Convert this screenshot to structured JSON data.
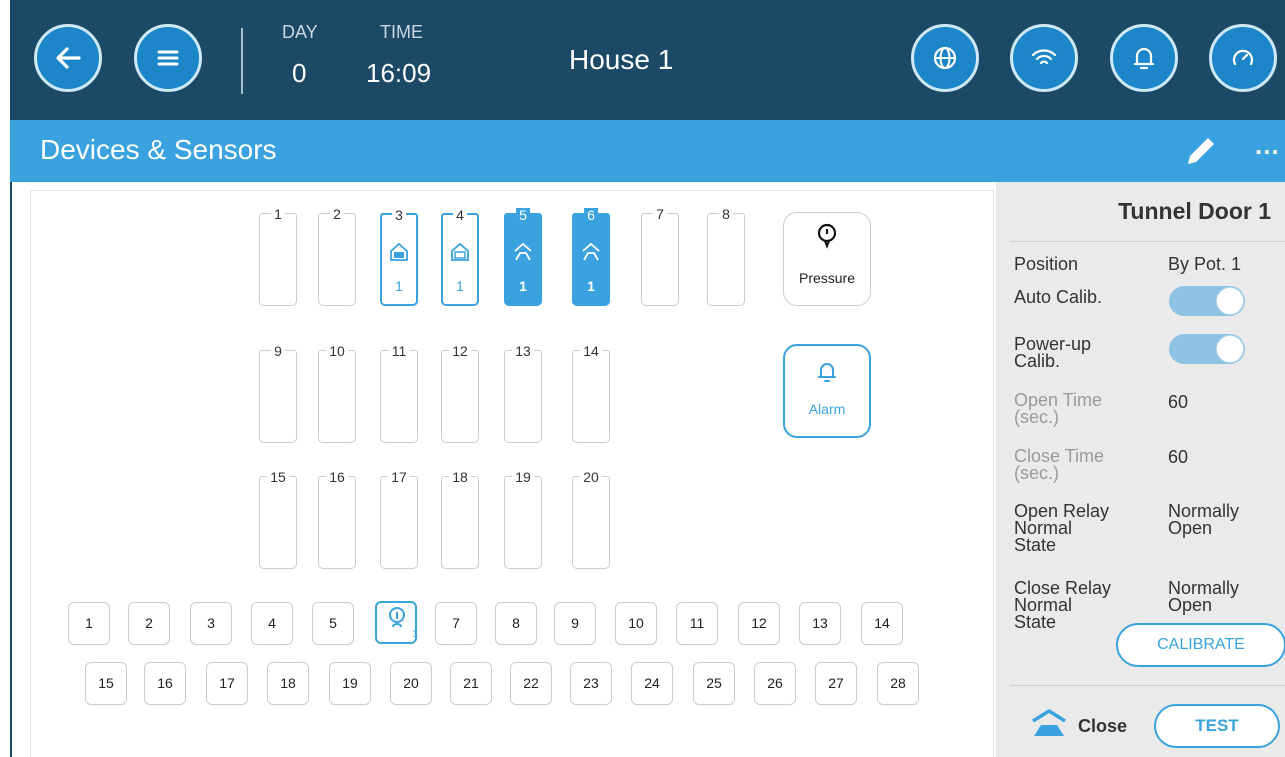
{
  "header": {
    "day_label": "DAY",
    "day_value": "0",
    "time_label": "TIME",
    "time_value": "16:09",
    "house_title": "House 1",
    "buttons": [
      "back-arrow-icon",
      "menu-icon",
      "globe-icon",
      "wifi-icon",
      "bell-icon",
      "gauge-icon"
    ]
  },
  "subheader": {
    "title": "Devices & Sensors",
    "edit_icon": "pencil-icon",
    "more_icon": "more-dots-icon",
    "more_label": "..."
  },
  "relays": {
    "row1": [
      {
        "num": "1",
        "state": "empty",
        "sub": ""
      },
      {
        "num": "2",
        "state": "empty",
        "sub": ""
      },
      {
        "num": "3",
        "state": "active",
        "icon": "tunnel-door-open-icon",
        "sub": "1"
      },
      {
        "num": "4",
        "state": "active",
        "icon": "tunnel-door-close-icon",
        "sub": "1"
      },
      {
        "num": "5",
        "state": "filled",
        "icon": "tunnel-door-open-icon",
        "sub": "1"
      },
      {
        "num": "6",
        "state": "filled",
        "icon": "tunnel-door-close-icon",
        "sub": "1"
      },
      {
        "num": "7",
        "state": "empty",
        "sub": ""
      },
      {
        "num": "8",
        "state": "empty",
        "sub": ""
      }
    ],
    "row2": [
      "9",
      "10",
      "11",
      "12",
      "13",
      "14"
    ],
    "row3": [
      "15",
      "16",
      "17",
      "18",
      "19",
      "20"
    ]
  },
  "sensors": {
    "pressure": {
      "label": "Pressure",
      "icon": "pressure-gauge-icon"
    },
    "alarm": {
      "label": "Alarm",
      "icon": "bell-icon"
    }
  },
  "analog_inputs": {
    "row1": [
      "1",
      "2",
      "3",
      "4",
      "5",
      "",
      "7",
      "8",
      "9",
      "10",
      "11",
      "12",
      "13",
      "14"
    ],
    "active": {
      "index": 5,
      "icon": "potentiometer-icon",
      "sub": "1"
    },
    "row2": [
      "15",
      "16",
      "17",
      "18",
      "19",
      "20",
      "21",
      "22",
      "23",
      "24",
      "25",
      "26",
      "27",
      "28"
    ]
  },
  "panel": {
    "title": "Tunnel Door 1",
    "position_label": "Position",
    "position_value": "By Pot. 1",
    "auto_calib_label": "Auto Calib.",
    "auto_calib_on": true,
    "powerup_label_1": "Power-up",
    "powerup_label_2": "Calib.",
    "powerup_on": true,
    "open_time_label_1": "Open Time",
    "open_time_label_2": "(sec.)",
    "open_time_value": "60",
    "close_time_label_1": "Close Time",
    "close_time_label_2": "(sec.)",
    "close_time_value": "60",
    "open_relay_label_1": "Open Relay",
    "open_relay_label_2": "Normal",
    "open_relay_label_3": "State",
    "open_relay_value_1": "Normally",
    "open_relay_value_2": "Open",
    "close_relay_label_1": "Close Relay",
    "close_relay_label_2": "Normal",
    "close_relay_label_3": "State",
    "close_relay_value_1": "Normally",
    "close_relay_value_2": "Open",
    "calibrate_label": "CALIBRATE",
    "status_icon": "tunnel-door-close-icon",
    "status_label": "Close",
    "test_label": "TEST"
  },
  "colors": {
    "header_bg": "#1c4a66",
    "subheader_bg": "#3aa3df",
    "accent": "#3aa3df",
    "panel_bg": "#eaeaea"
  }
}
